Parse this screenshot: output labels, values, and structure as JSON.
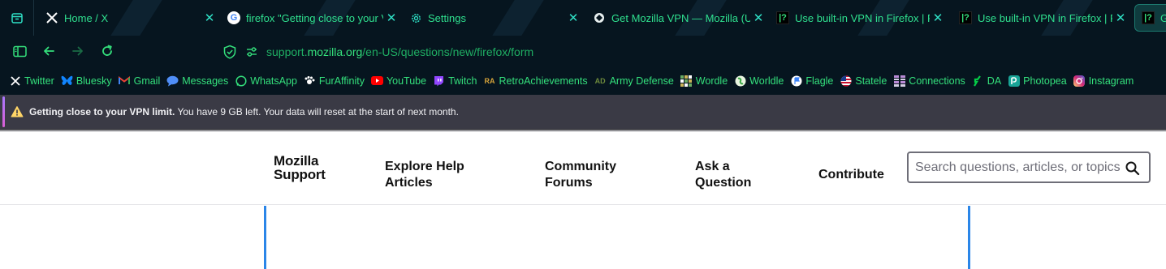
{
  "colors": {
    "chrome_bg": "#06151f",
    "accent_green": "#34e07c",
    "notification_bg": "#3a3a45",
    "frame_blue": "#2b86e8"
  },
  "tabs": [
    {
      "icon": "x-logo-icon",
      "title": "Home / X"
    },
    {
      "icon": "google-icon",
      "title": "firefox \"Getting close to your VPN limit\""
    },
    {
      "icon": "gear-icon",
      "title": "Settings"
    },
    {
      "icon": "mozilla-vpn-icon",
      "title": "Get Mozilla VPN — Mozilla (US)"
    },
    {
      "icon": "mozilla-support-icon",
      "title": "Use built-in VPN in Firefox | Firefox Help"
    },
    {
      "icon": "mozilla-support-icon",
      "title": "Use built-in VPN in Firefox | Firefox Help"
    },
    {
      "icon": "mozilla-support-icon",
      "title": "Ge"
    }
  ],
  "address": {
    "prefix": "support.",
    "domain": "mozilla.org",
    "path": "/en-US/questions/new/firefox/form"
  },
  "bookmarks": [
    {
      "icon": "x-logo-icon",
      "label": "Twitter"
    },
    {
      "icon": "bluesky-icon",
      "label": "Bluesky"
    },
    {
      "icon": "gmail-icon",
      "label": "Gmail"
    },
    {
      "icon": "messages-icon",
      "label": "Messages"
    },
    {
      "icon": "whatsapp-icon",
      "label": "WhatsApp"
    },
    {
      "icon": "furaffinity-icon",
      "label": "FurAffinity"
    },
    {
      "icon": "youtube-icon",
      "label": "YouTube"
    },
    {
      "icon": "twitch-icon",
      "label": "Twitch"
    },
    {
      "icon": "retroachievements-icon",
      "label": "RetroAchievements"
    },
    {
      "icon": "army-defense-icon",
      "label": "Army Defense"
    },
    {
      "icon": "wordle-icon",
      "label": "Wordle"
    },
    {
      "icon": "worldle-icon",
      "label": "Worldle"
    },
    {
      "icon": "flagle-icon",
      "label": "Flagle"
    },
    {
      "icon": "us-flag-icon",
      "label": "Statele"
    },
    {
      "icon": "connections-icon",
      "label": "Connections"
    },
    {
      "icon": "da-icon",
      "label": "DA"
    },
    {
      "icon": "photopea-icon",
      "label": "Photopea"
    },
    {
      "icon": "instagram-icon",
      "label": "Instagram"
    }
  ],
  "notification": {
    "title": "Getting close to your VPN limit.",
    "message": "You have 9 GB left. Your data will reset at the start of next month."
  },
  "site": {
    "logo_line1": "Mozilla",
    "logo_line2": "Support",
    "nav": [
      {
        "line1": "Explore Help",
        "line2": "Articles"
      },
      {
        "line1": "Community",
        "line2": "Forums"
      },
      {
        "line1": "Ask a",
        "line2": "Question"
      },
      {
        "line1": "Contribute",
        "line2": ""
      }
    ],
    "search_placeholder": "Search questions, articles, or topics"
  }
}
